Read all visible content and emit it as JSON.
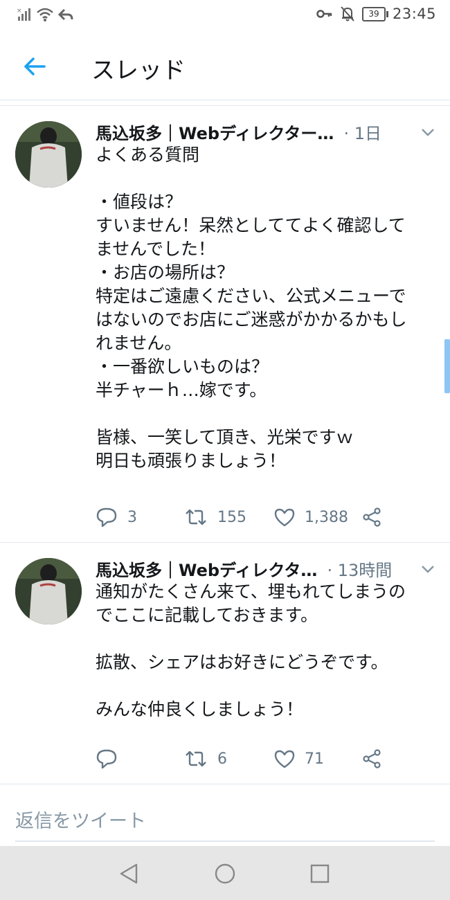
{
  "status_bar": {
    "time": "23:45",
    "battery": "39",
    "icons": [
      "signal-icon",
      "wifi-icon",
      "reply-arrow-icon",
      "key-icon",
      "mute-bell-icon",
      "battery-icon"
    ]
  },
  "header": {
    "title": "スレッド",
    "back_icon": "back-arrow-icon",
    "accent_color": "#1da1f2"
  },
  "tweets": [
    {
      "name": "馬込坂多｜Webディレクター…",
      "time": "· 1日",
      "lines": [
        "よくある質問",
        "",
        "・値段は？",
        "すいません！呆然としててよく確認して",
        "ませんでした！",
        "・お店の場所は？",
        "特定はご遠慮ください、公式メニューで",
        "はないのでお店にご迷惑がかかるかもし",
        "れません。",
        "・一番欲しいものは？",
        "半チャーｈ…嫁です。",
        "",
        "皆様、一笑して頂き、光栄ですｗ",
        "明日も頑張りましょう！"
      ],
      "replies": "3",
      "retweets": "155",
      "likes": "1,388"
    },
    {
      "name": "馬込坂多｜Webディレクタ…",
      "time": "· 13時間",
      "lines": [
        "通知がたくさん来て、埋もれてしまうの",
        "でここに記載しておきます。",
        "",
        "拡散、シェアはお好きにどうぞです。",
        "",
        "みんな仲良くしましょう！"
      ],
      "replies": "",
      "retweets": "6",
      "likes": "71"
    }
  ],
  "reply_box": {
    "placeholder": "返信をツイート"
  },
  "colors": {
    "text": "#14171a",
    "secondary": "#657786",
    "border": "#e1e8ed"
  }
}
